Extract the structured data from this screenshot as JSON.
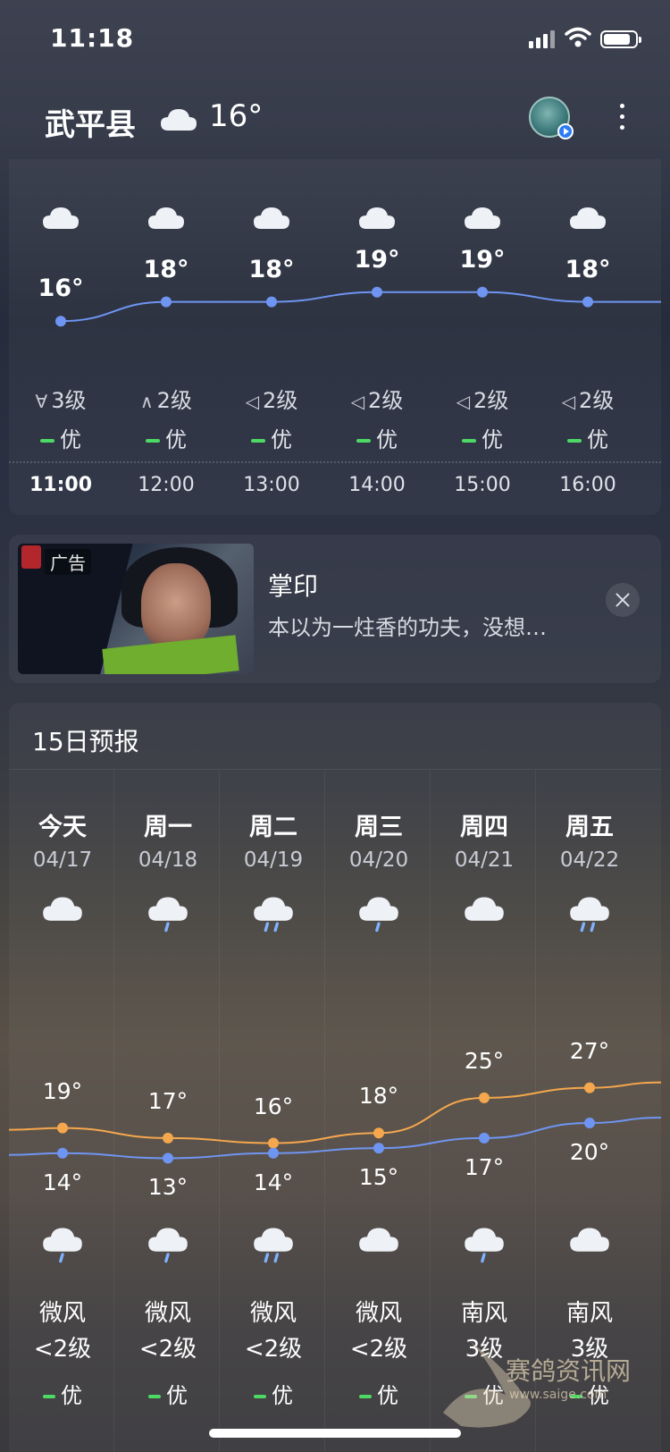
{
  "status": {
    "time": "11:18",
    "battery_icon": "battery-icon",
    "wifi_icon": "wifi-icon",
    "signal_icon": "signal-icon"
  },
  "header": {
    "city": "武平县",
    "weather_icon": "cloud-icon",
    "temp": "16°",
    "avatar_icon": "avatar",
    "more_icon": "more-vertical-icon"
  },
  "hourly": {
    "items": [
      {
        "time": "11:00",
        "icon": "cloud-icon",
        "temp": "16°",
        "temp_value": 16,
        "wind": "3级",
        "wind_dir": "∀",
        "aqi": "优"
      },
      {
        "time": "12:00",
        "icon": "cloud-icon",
        "temp": "18°",
        "temp_value": 18,
        "wind": "2级",
        "wind_dir": "∧",
        "aqi": "优"
      },
      {
        "time": "13:00",
        "icon": "cloud-icon",
        "temp": "18°",
        "temp_value": 18,
        "wind": "2级",
        "wind_dir": "◁",
        "aqi": "优"
      },
      {
        "time": "14:00",
        "icon": "cloud-icon",
        "temp": "19°",
        "temp_value": 19,
        "wind": "2级",
        "wind_dir": "◁",
        "aqi": "优"
      },
      {
        "time": "15:00",
        "icon": "cloud-icon",
        "temp": "19°",
        "temp_value": 19,
        "wind": "2级",
        "wind_dir": "◁",
        "aqi": "优"
      },
      {
        "time": "16:00",
        "icon": "cloud-icon",
        "temp": "18°",
        "temp_value": 18,
        "wind": "2级",
        "wind_dir": "◁",
        "aqi": "优"
      }
    ],
    "line_color": "#6f95f2"
  },
  "ad": {
    "tag": "广告",
    "title": "掌印",
    "desc": "本以为一炷香的功夫，没想…",
    "close_icon": "close-icon"
  },
  "daily": {
    "title": "15日预报",
    "high_color": "#f5a74d",
    "low_color": "#6f95f2",
    "aqi_color": "#4cd964",
    "days": [
      {
        "week": "今天",
        "date": "04/17",
        "icon_day": "cloud-icon",
        "icon_night": "rain-icon",
        "high": "19°",
        "low": "14°",
        "high_value": 19,
        "low_value": 14,
        "wind": "微风",
        "level": "<2级",
        "aqi": "优"
      },
      {
        "week": "周一",
        "date": "04/18",
        "icon_day": "rain-icon",
        "icon_night": "rain-icon",
        "high": "17°",
        "low": "13°",
        "high_value": 17,
        "low_value": 13,
        "wind": "微风",
        "level": "<2级",
        "aqi": "优"
      },
      {
        "week": "周二",
        "date": "04/19",
        "icon_day": "heavy-rain-icon",
        "icon_night": "heavy-rain-icon",
        "high": "16°",
        "low": "14°",
        "high_value": 16,
        "low_value": 14,
        "wind": "微风",
        "level": "<2级",
        "aqi": "优"
      },
      {
        "week": "周三",
        "date": "04/20",
        "icon_day": "rain-icon",
        "icon_night": "cloud-icon",
        "high": "18°",
        "low": "15°",
        "high_value": 18,
        "low_value": 15,
        "wind": "微风",
        "level": "<2级",
        "aqi": "优"
      },
      {
        "week": "周四",
        "date": "04/21",
        "icon_day": "cloud-icon",
        "icon_night": "rain-icon",
        "high": "25°",
        "low": "17°",
        "high_value": 25,
        "low_value": 17,
        "wind": "南风",
        "level": "3级",
        "aqi": "优"
      },
      {
        "week": "周五",
        "date": "04/22",
        "icon_day": "heavy-rain-icon",
        "icon_night": "cloud-icon",
        "high": "27°",
        "low": "20°",
        "high_value": 27,
        "low_value": 20,
        "wind": "南风",
        "level": "3级",
        "aqi": "优"
      }
    ]
  },
  "watermark": {
    "text": "赛鸽资讯网",
    "url": "www.saige.com"
  }
}
